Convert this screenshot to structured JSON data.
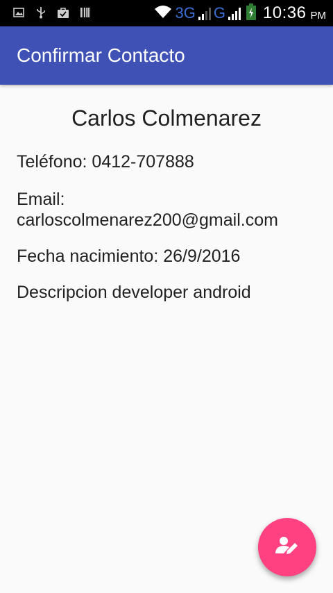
{
  "status_bar": {
    "icons": [
      "image-icon",
      "usb-icon",
      "shopping-bag-icon",
      "barcode-icon",
      "wifi-icon",
      "battery-charging-icon"
    ],
    "network_1": "3G",
    "network_2": "G",
    "time": "10:36",
    "ampm": "PM"
  },
  "app_bar": {
    "title": "Confirmar Contacto"
  },
  "contact": {
    "name": "Carlos Colmenarez",
    "phone": "Teléfono: 0412-707888",
    "email_label": "Email:",
    "email": "carloscolmenarez200@gmail.com",
    "birth": "Fecha nacimiento: 26/9/2016",
    "description": "Descripcion developer android"
  },
  "fab": {
    "icon": "edit-contact-icon"
  },
  "colors": {
    "primary": "#3f51b5",
    "accent": "#ff4081",
    "background": "#fafafa"
  }
}
